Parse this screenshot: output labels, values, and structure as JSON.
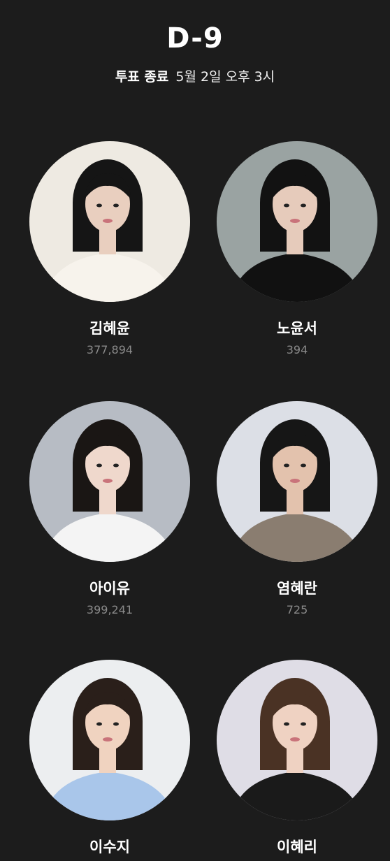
{
  "header": {
    "dday": "D-9",
    "deadline_label": "투표 종료",
    "deadline_value": "5월 2일 오후 3시"
  },
  "candidates": [
    {
      "name": "김혜윤",
      "votes": "377,894",
      "bg": "#eeeae2",
      "hair": "#151515",
      "skin": "#e9cfbf",
      "top": "#f7f3ec"
    },
    {
      "name": "노윤서",
      "votes": "394",
      "bg": "#9aa3a2",
      "hair": "#121212",
      "skin": "#e6cbbb",
      "top": "#111111"
    },
    {
      "name": "아이유",
      "votes": "399,241",
      "bg": "#b7bcc4",
      "hair": "#1a1614",
      "skin": "#efd8cc",
      "top": "#f4f4f4"
    },
    {
      "name": "염혜란",
      "votes": "725",
      "bg": "#dcdfe6",
      "hair": "#161616",
      "skin": "#e3c2ad",
      "top": "#8a7d70"
    },
    {
      "name": "이수지",
      "votes": "",
      "bg": "#eceef0",
      "hair": "#2a1f1a",
      "skin": "#f0d3c0",
      "top": "#a9c6ea"
    },
    {
      "name": "이혜리",
      "votes": "",
      "bg": "#dfdde6",
      "hair": "#4a3224",
      "skin": "#efd2c2",
      "top": "#1a1a1a"
    }
  ]
}
